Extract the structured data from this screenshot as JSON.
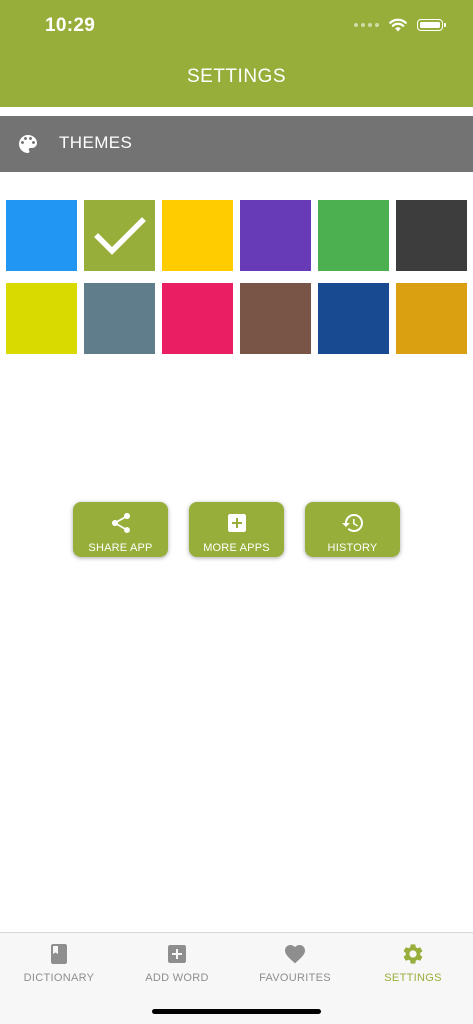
{
  "status_bar": {
    "time": "10:29"
  },
  "header": {
    "title": "SETTINGS",
    "color": "#97AF3A"
  },
  "section": {
    "title": "THEMES",
    "icon": "palette-icon",
    "color": "#737373"
  },
  "themes": {
    "selected_index": 1,
    "swatches": [
      {
        "color": "#2196F3"
      },
      {
        "color": "#97AF3A"
      },
      {
        "color": "#FFCC00"
      },
      {
        "color": "#673AB7"
      },
      {
        "color": "#4CAF50"
      },
      {
        "color": "#3D3D3D"
      },
      {
        "color": "#D9DB00"
      },
      {
        "color": "#607D8B"
      },
      {
        "color": "#E91E63"
      },
      {
        "color": "#795548"
      },
      {
        "color": "#174A91"
      },
      {
        "color": "#DBA012"
      }
    ]
  },
  "actions": [
    {
      "label": "SHARE APP",
      "icon": "share-icon"
    },
    {
      "label": "MORE APPS",
      "icon": "add-box-icon"
    },
    {
      "label": "HISTORY",
      "icon": "history-icon"
    }
  ],
  "tabbar": {
    "active": "settings",
    "tabs": [
      {
        "id": "dictionary",
        "label": "DICTIONARY",
        "icon": "book-icon"
      },
      {
        "id": "add_word",
        "label": "ADD WORD",
        "icon": "add-box-icon"
      },
      {
        "id": "favourites",
        "label": "FAVOURITES",
        "icon": "heart-icon"
      },
      {
        "id": "settings",
        "label": "SETTINGS",
        "icon": "gear-icon"
      }
    ],
    "inactive_color": "#8E8E8E",
    "active_color": "#97AF3A"
  }
}
